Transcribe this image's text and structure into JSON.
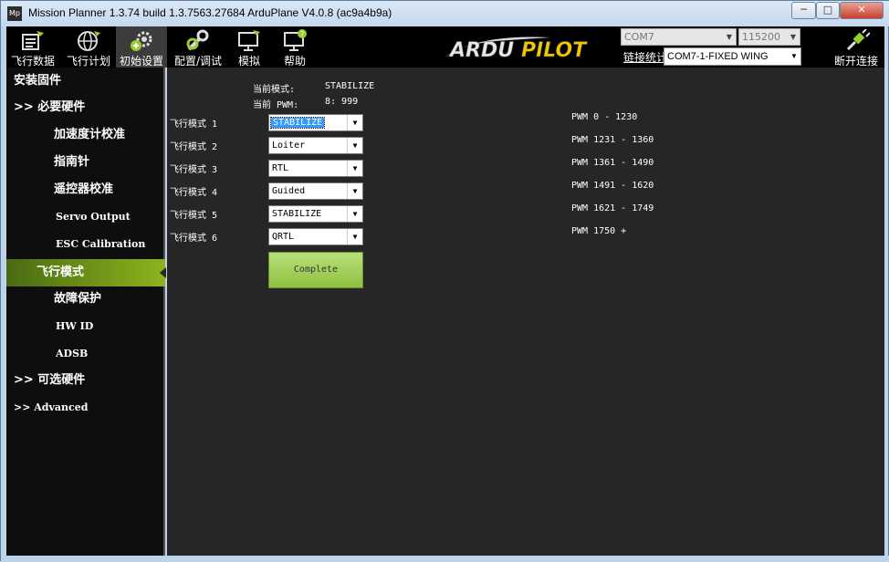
{
  "window": {
    "title": "Mission Planner 1.3.74 build 1.3.7563.27684 ArduPlane V4.0.8 (ac9a4b9a)",
    "app_icon_text": "Mp",
    "minimize": "─",
    "maximize": "□",
    "close": "✕"
  },
  "toolbar": {
    "items": [
      {
        "label": "飞行数据",
        "icon": "flight-data-icon"
      },
      {
        "label": "飞行计划",
        "icon": "globe-icon"
      },
      {
        "label": "初始设置",
        "icon": "gears-icon"
      },
      {
        "label": "配置/调试",
        "icon": "wrench-icon"
      },
      {
        "label": "模拟",
        "icon": "monitor-icon"
      },
      {
        "label": "帮助",
        "icon": "help-monitor-icon"
      }
    ],
    "active_index": 2,
    "logo_text": "ARDUPILOT",
    "port": "COM7",
    "baud": "115200",
    "link_stats": "链接统计",
    "vehicle": "COM7-1-FIXED WING",
    "disconnect": "断开连接"
  },
  "sidebar": {
    "items": [
      {
        "label": "安装固件",
        "level": 0
      },
      {
        "label": ">> 必要硬件",
        "level": 0
      },
      {
        "label": "加速度计校准",
        "level": 1
      },
      {
        "label": "指南针",
        "level": 1
      },
      {
        "label": "遥控器校准",
        "level": 1
      },
      {
        "label": "Servo Output",
        "level": 1
      },
      {
        "label": "ESC Calibration",
        "level": 1
      },
      {
        "label": "飞行模式",
        "level": 1,
        "active": true
      },
      {
        "label": "故障保护",
        "level": 1
      },
      {
        "label": "HW ID",
        "level": 1
      },
      {
        "label": "ADSB",
        "level": 1
      },
      {
        "label": ">> 可选硬件",
        "level": 0
      },
      {
        "label": ">> Advanced",
        "level": 0
      }
    ]
  },
  "flight_modes": {
    "current_mode_label": "当前模式:",
    "current_mode_value": "STABILIZE",
    "current_pwm_label": "当前 PWM:",
    "current_pwm_value": "8: 999",
    "modes": [
      {
        "label": "飞行模式 1",
        "value": "STABILIZE",
        "pwm": "PWM 0 - 1230"
      },
      {
        "label": "飞行模式 2",
        "value": "Loiter",
        "pwm": "PWM 1231 - 1360"
      },
      {
        "label": "飞行模式 3",
        "value": "RTL",
        "pwm": "PWM 1361 - 1490"
      },
      {
        "label": "飞行模式 4",
        "value": "Guided",
        "pwm": "PWM 1491 - 1620"
      },
      {
        "label": "飞行模式 5",
        "value": "STABILIZE",
        "pwm": "PWM 1621 - 1749"
      },
      {
        "label": "飞行模式 6",
        "value": "QRTL",
        "pwm": "PWM 1750 +"
      }
    ],
    "complete_label": "Complete"
  },
  "colors": {
    "accent_green": "#8cb41e",
    "panel_bg": "#262626",
    "sidebar_bg": "#0e0e0e",
    "logo_yellow": "#f2c800"
  }
}
